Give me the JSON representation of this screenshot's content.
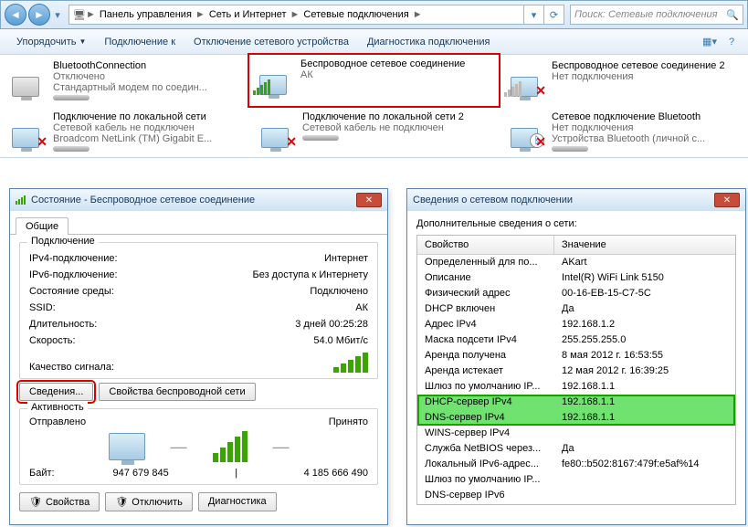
{
  "navbar": {
    "back": "◄",
    "forward": "►",
    "dd": "▾",
    "crumbs": [
      "Панель управления",
      "Сеть и Интернет",
      "Сетевые подключения"
    ],
    "sep": "►",
    "refresh": "⟳",
    "search_placeholder": "Поиск: Сетевые подключения"
  },
  "toolbar": {
    "organize": "Упорядочить",
    "connect_to": "Подключение к",
    "disable": "Отключение сетевого устройства",
    "diag": "Диагностика подключения",
    "view_icon": "▦",
    "help_icon": "?"
  },
  "connections": [
    {
      "title": "BluetoothConnection",
      "sub1": "Отключено",
      "sub2": "Стандартный модем по соедин...",
      "kind": "bt_disabled"
    },
    {
      "title": "Беспроводное сетевое соединение",
      "sub1": "АК",
      "sub2": "",
      "kind": "wifi_on",
      "highlighted": true
    },
    {
      "title": "Беспроводное сетевое соединение 2",
      "sub1": "Нет подключения",
      "sub2": "",
      "kind": "wifi_off"
    },
    {
      "title": "Подключение по локальной сети",
      "sub1": "Сетевой кабель не подключен",
      "sub2": "Broadcom NetLink (TM) Gigabit E...",
      "kind": "lan_x"
    },
    {
      "title": "Подключение по локальной сети 2",
      "sub1": "Сетевой кабель не подключен",
      "sub2": "",
      "kind": "lan_x"
    },
    {
      "title": "Сетевое подключение Bluetooth",
      "sub1": "Нет подключения",
      "sub2": "Устройства Bluetooth (личной с...",
      "kind": "bt_x"
    }
  ],
  "status_dialog": {
    "title": "Состояние - Беспроводное сетевое соединение",
    "tab": "Общие",
    "grp_conn": "Подключение",
    "rows": [
      {
        "k": "IPv4-подключение:",
        "v": "Интернет"
      },
      {
        "k": "IPv6-подключение:",
        "v": "Без доступа к Интернету"
      },
      {
        "k": "Состояние среды:",
        "v": "Подключено"
      },
      {
        "k": "SSID:",
        "v": "АК"
      },
      {
        "k": "Длительность:",
        "v": "3 дней 00:25:28"
      },
      {
        "k": "Скорость:",
        "v": "54.0 Мбит/с"
      }
    ],
    "signal_label": "Качество сигнала:",
    "details_btn": "Сведения...",
    "wifi_props_btn": "Свойства беспроводной сети",
    "grp_activity": "Активность",
    "sent_label": "Отправлено",
    "recv_label": "Принято",
    "bytes_label": "Байт:",
    "sent_bytes": "947 679 845",
    "recv_bytes": "4 185 666 490",
    "props_btn": "Свойства",
    "disable_btn": "Отключить",
    "diag_btn": "Диагностика"
  },
  "details_dialog": {
    "title": "Сведения о сетевом подключении",
    "subtitle": "Дополнительные сведения о сети:",
    "col_prop": "Свойство",
    "col_val": "Значение",
    "rows": [
      {
        "p": "Определенный для по...",
        "v": "AKart"
      },
      {
        "p": "Описание",
        "v": "Intel(R) WiFi Link 5150"
      },
      {
        "p": "Физический адрес",
        "v": "00-16-EB-15-C7-5C"
      },
      {
        "p": "DHCP включен",
        "v": "Да"
      },
      {
        "p": "Адрес IPv4",
        "v": "192.168.1.2"
      },
      {
        "p": "Маска подсети IPv4",
        "v": "255.255.255.0"
      },
      {
        "p": "Аренда получена",
        "v": "8 мая 2012 г. 16:53:55"
      },
      {
        "p": "Аренда истекает",
        "v": "12 мая 2012 г. 16:39:25"
      },
      {
        "p": "Шлюз по умолчанию IP...",
        "v": "192.168.1.1"
      },
      {
        "p": "DHCP-сервер IPv4",
        "v": "192.168.1.1",
        "hl": true
      },
      {
        "p": "DNS-сервер IPv4",
        "v": "192.168.1.1",
        "hl": true
      },
      {
        "p": "WINS-сервер IPv4",
        "v": ""
      },
      {
        "p": "Служба NetBIOS через...",
        "v": "Да"
      },
      {
        "p": "Локальный IPv6-адрес...",
        "v": "fe80::b502:8167:479f:e5af%14"
      },
      {
        "p": "Шлюз по умолчанию IP...",
        "v": ""
      },
      {
        "p": "DNS-сервер IPv6",
        "v": ""
      }
    ]
  }
}
